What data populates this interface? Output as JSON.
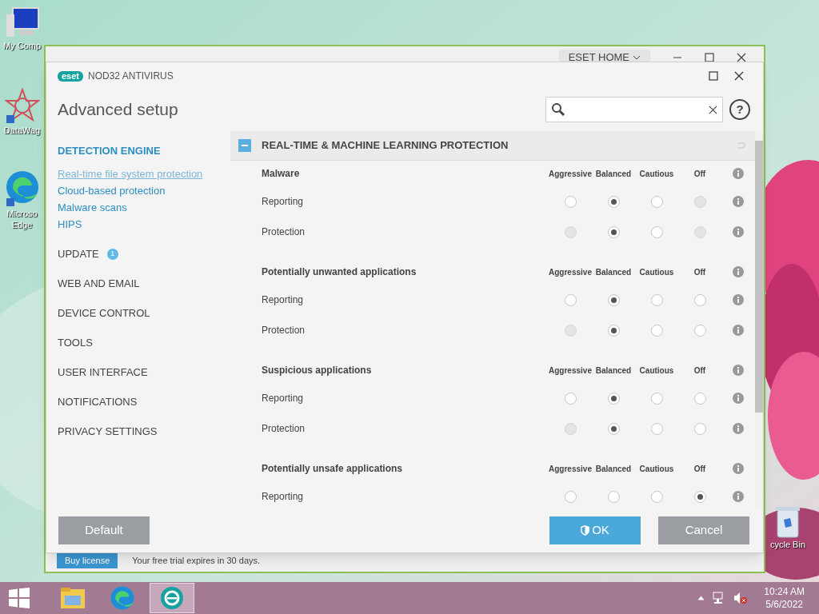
{
  "desktop_icons": [
    {
      "kind": "computer",
      "lines": [
        "My Comp"
      ]
    },
    {
      "kind": "star",
      "lines": [
        "DataWag"
      ]
    },
    {
      "kind": "edge",
      "lines": [
        "Microso",
        "Edge"
      ]
    },
    {
      "kind": "bin",
      "lines": [
        "cycle Bin"
      ]
    }
  ],
  "background_window": {
    "account": "ESET HOME",
    "buy_button": "Buy license",
    "trial_text": "Your free trial expires in 30 days."
  },
  "dialog": {
    "brand": "eset",
    "product": "NOD32 ANTIVIRUS",
    "title": "Advanced setup",
    "help": "?",
    "sidebar": [
      {
        "label": "DETECTION ENGINE",
        "selected": true,
        "children": [
          {
            "label": "Real-time file system protection",
            "selected": true
          },
          {
            "label": "Cloud-based protection",
            "selected": false
          },
          {
            "label": "Malware scans",
            "selected": false
          },
          {
            "label": "HIPS",
            "selected": false
          }
        ]
      },
      {
        "label": "UPDATE",
        "selected": false,
        "badge": "1"
      },
      {
        "label": "WEB AND EMAIL",
        "selected": false
      },
      {
        "label": "DEVICE CONTROL",
        "selected": false
      },
      {
        "label": "TOOLS",
        "selected": false
      },
      {
        "label": "USER INTERFACE",
        "selected": false
      },
      {
        "label": "NOTIFICATIONS",
        "selected": false
      },
      {
        "label": "PRIVACY SETTINGS",
        "selected": false
      }
    ],
    "section": {
      "title": "REAL-TIME & MACHINE LEARNING PROTECTION",
      "expanded": true
    },
    "groups": [
      {
        "title": "Malware",
        "columns": [
          "Aggressive",
          "Balanced",
          "Cautious",
          "Off"
        ],
        "rows": [
          {
            "label": "Reporting",
            "options": [
              {
                "selected": false,
                "disabled": false
              },
              {
                "selected": true,
                "disabled": false
              },
              {
                "selected": false,
                "disabled": false
              },
              {
                "selected": false,
                "disabled": true
              }
            ]
          },
          {
            "label": "Protection",
            "options": [
              {
                "selected": false,
                "disabled": true
              },
              {
                "selected": true,
                "disabled": false
              },
              {
                "selected": false,
                "disabled": false
              },
              {
                "selected": false,
                "disabled": true
              }
            ]
          }
        ]
      },
      {
        "title": "Potentially unwanted applications",
        "columns": [
          "Aggressive",
          "Balanced",
          "Cautious",
          "Off"
        ],
        "rows": [
          {
            "label": "Reporting",
            "options": [
              {
                "selected": false,
                "disabled": false
              },
              {
                "selected": true,
                "disabled": false
              },
              {
                "selected": false,
                "disabled": false
              },
              {
                "selected": false,
                "disabled": false
              }
            ]
          },
          {
            "label": "Protection",
            "options": [
              {
                "selected": false,
                "disabled": true
              },
              {
                "selected": true,
                "disabled": false
              },
              {
                "selected": false,
                "disabled": false
              },
              {
                "selected": false,
                "disabled": false
              }
            ]
          }
        ]
      },
      {
        "title": "Suspicious applications",
        "columns": [
          "Aggressive",
          "Balanced",
          "Cautious",
          "Off"
        ],
        "rows": [
          {
            "label": "Reporting",
            "options": [
              {
                "selected": false,
                "disabled": false
              },
              {
                "selected": true,
                "disabled": false
              },
              {
                "selected": false,
                "disabled": false
              },
              {
                "selected": false,
                "disabled": false
              }
            ]
          },
          {
            "label": "Protection",
            "options": [
              {
                "selected": false,
                "disabled": true
              },
              {
                "selected": true,
                "disabled": false
              },
              {
                "selected": false,
                "disabled": false
              },
              {
                "selected": false,
                "disabled": false
              }
            ]
          }
        ]
      },
      {
        "title": "Potentially unsafe applications",
        "columns": [
          "Aggressive",
          "Balanced",
          "Cautious",
          "Off"
        ],
        "rows": [
          {
            "label": "Reporting",
            "options": [
              {
                "selected": false,
                "disabled": false
              },
              {
                "selected": false,
                "disabled": false
              },
              {
                "selected": false,
                "disabled": false
              },
              {
                "selected": true,
                "disabled": false
              }
            ]
          }
        ]
      }
    ],
    "buttons": [
      {
        "label": "Default",
        "kind": "secondary"
      },
      {
        "label": "OK",
        "kind": "primary"
      },
      {
        "label": "Cancel",
        "kind": "secondary"
      }
    ]
  },
  "taskbar": {
    "apps": [
      {
        "kind": "folder",
        "selected": false
      },
      {
        "kind": "edge",
        "selected": false
      },
      {
        "kind": "eset",
        "selected": true
      }
    ],
    "time": "10:24 AM",
    "date": "5/6/2022"
  }
}
